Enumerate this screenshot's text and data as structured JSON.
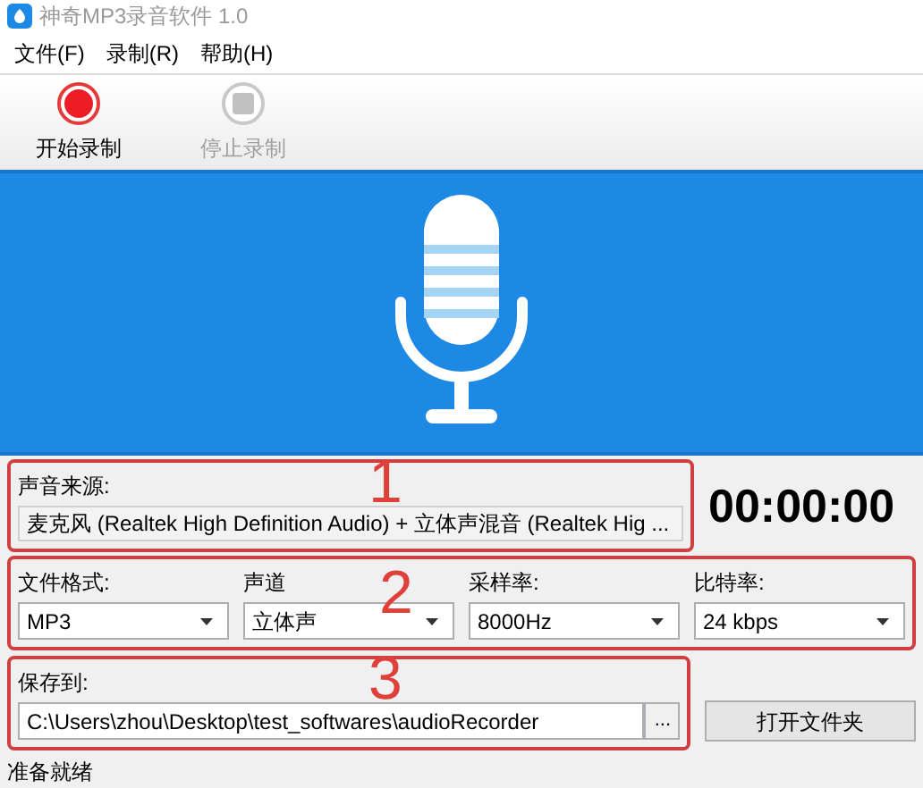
{
  "window": {
    "title": "神奇MP3录音软件 1.0"
  },
  "menu": [
    {
      "label": "文件(F)"
    },
    {
      "label": "录制(R)"
    },
    {
      "label": "帮助(H)"
    }
  ],
  "toolbar": [
    {
      "label": "开始录制",
      "kind": "record",
      "disabled": false
    },
    {
      "label": "停止录制",
      "kind": "stop",
      "disabled": true
    }
  ],
  "source": {
    "label": "声音来源:",
    "value": "麦克风 (Realtek High Definition Audio) + 立体声混音 (Realtek Hig ...",
    "annotation": "1"
  },
  "timer": "00:00:00",
  "settings": {
    "annotation": "2",
    "fields": [
      {
        "label": "文件格式:",
        "value": "MP3"
      },
      {
        "label": "声道",
        "value": "立体声"
      },
      {
        "label": "采样率:",
        "value": "8000Hz"
      },
      {
        "label": "比特率:",
        "value": "24 kbps"
      }
    ]
  },
  "save": {
    "label": "保存到:",
    "value": "C:\\Users\\zhou\\Desktop\\test_softwares\\audioRecorder",
    "browse": "...",
    "annotation": "3"
  },
  "open_folder": "打开文件夹",
  "status_bar": "准备就绪"
}
